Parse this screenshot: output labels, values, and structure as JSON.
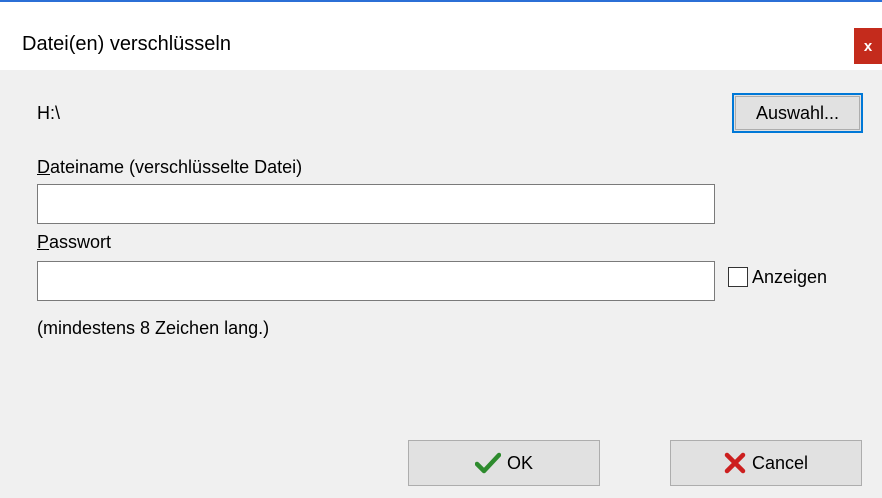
{
  "window": {
    "title": "Datei(en) verschlüsseln",
    "close_label": "x"
  },
  "location": {
    "path": "H:\\",
    "browse_label": "Auswahl..."
  },
  "filename": {
    "label_accel": "D",
    "label_rest": "ateiname (verschlüsselte Datei)",
    "value": ""
  },
  "password": {
    "label_accel": "P",
    "label_rest": "asswort",
    "value": "",
    "show_label": "Anzeigen",
    "show_checked": false,
    "hint": "(mindestens 8 Zeichen lang.)"
  },
  "actions": {
    "ok_label": "OK",
    "cancel_label": "Cancel"
  },
  "colors": {
    "accent": "#2b6fd6",
    "close_bg": "#c42b1c",
    "ok_icon": "#2e8b2e",
    "cancel_icon": "#cc1f1f"
  },
  "icons": {
    "ok": "checkmark-icon",
    "cancel": "x-mark-icon"
  }
}
